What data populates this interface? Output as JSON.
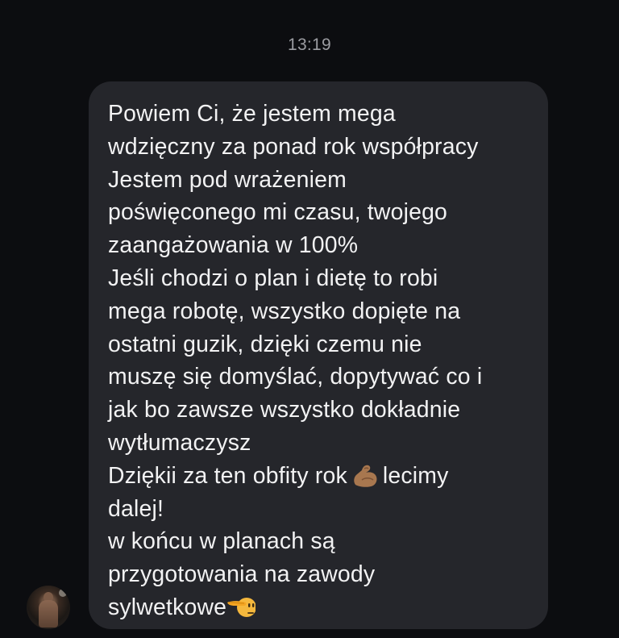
{
  "chat": {
    "timestamp": "13:19",
    "message": {
      "lines": [
        "Powiem Ci, że jestem mega",
        "wdzięczny za ponad rok współpracy",
        "Jestem pod wrażeniem",
        "poświęconego mi czasu, twojego",
        "zaangażowania w 100%",
        "Jeśli chodzi o plan i dietę to robi",
        "mega robotę, wszystko dopięte na",
        "ostatni guzik, dzięki czemu nie",
        "muszę się domyślać, dopytywać co i",
        "jak bo zawsze wszystko dokładnie",
        "wytłumaczysz",
        "Dziękii za ten obfity rok",
        "lecimy",
        "dalej!",
        "w końcu w planach są",
        "przygotowania na zawody",
        "sylwetkowe"
      ],
      "emojis": [
        "flexed-biceps-emoji",
        "saluting-face-emoji"
      ]
    },
    "colors": {
      "background": "#0c0d10",
      "bubble": "#25262b",
      "text": "#f2f2f3",
      "timestamp": "#9b9ca1"
    }
  }
}
